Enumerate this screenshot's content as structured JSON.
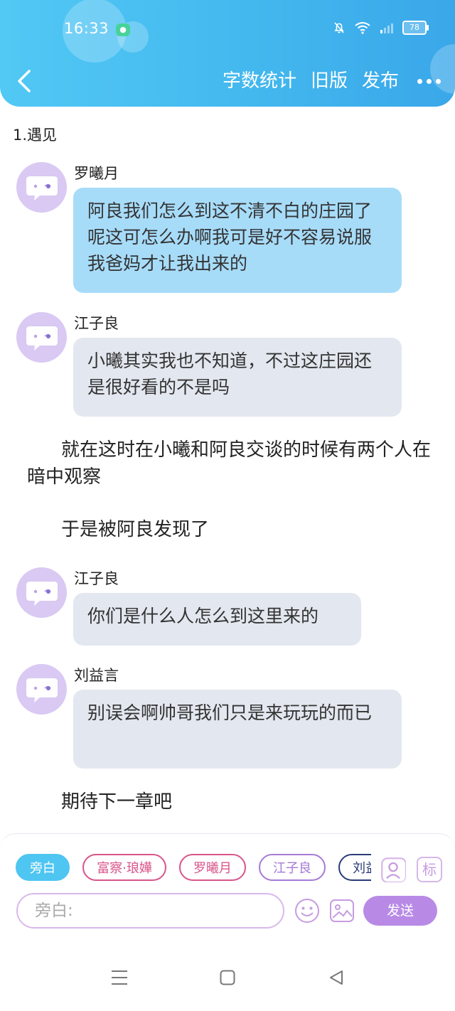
{
  "status_bar": {
    "time": "16:33",
    "battery": "78"
  },
  "header": {
    "actions": [
      "字数统计",
      "旧版",
      "发布"
    ]
  },
  "chapter": {
    "title": "1.遇见"
  },
  "messages": [
    {
      "type": "dialog",
      "speaker": "罗曦月",
      "text": "阿良我们怎么到这不清不白的庄园了呢这可怎么办啊我可是好不容易说服我爸妈才让我出来的",
      "style": "blue"
    },
    {
      "type": "dialog",
      "speaker": "江子良",
      "text": "小曦其实我也不知道，不过这庄园还是很好看的不是吗",
      "style": "grey"
    },
    {
      "type": "narration",
      "text": "就在这时在小曦和阿良交谈的时候有两个人在暗中观察"
    },
    {
      "type": "narration",
      "text": "于是被阿良发现了"
    },
    {
      "type": "dialog",
      "speaker": "江子良",
      "text": "你们是什么人怎么到这里来的",
      "style": "grey"
    },
    {
      "type": "dialog",
      "speaker": "刘益言",
      "text": "别误会啊帅哥我们只是来玩玩的而已",
      "style": "grey"
    },
    {
      "type": "narration",
      "text": "期待下一章吧"
    }
  ],
  "composer": {
    "roles": [
      {
        "label": "旁白",
        "selected": true,
        "color": "#4fc5f2"
      },
      {
        "label": "富察·琅嬅",
        "selected": false,
        "color": "#d9558a"
      },
      {
        "label": "罗曦月",
        "selected": false,
        "color": "#d9558a"
      },
      {
        "label": "江子良",
        "selected": false,
        "color": "#a57ad6"
      },
      {
        "label": "刘益言",
        "selected": false,
        "color": "#2a3b78"
      }
    ],
    "mark_label": "标",
    "input_placeholder": "旁白:",
    "send_label": "发送"
  },
  "colors": {
    "header": "#43b8ee",
    "bubble_blue": "#a7dcf9",
    "bubble_grey": "#e3e7ef",
    "avatar": "#d9c9f3",
    "send": "#b88ae6"
  }
}
